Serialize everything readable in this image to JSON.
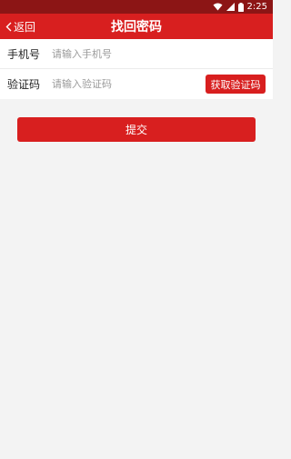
{
  "status_bar": {
    "time": "2:25"
  },
  "nav": {
    "back_label": "返回",
    "title": "找回密码"
  },
  "form": {
    "phone": {
      "label": "手机号",
      "placeholder": "请输入手机号",
      "value": ""
    },
    "code": {
      "label": "验证码",
      "placeholder": "请输入验证码",
      "value": "",
      "button_label": "获取验证码"
    }
  },
  "submit_label": "提交",
  "colors": {
    "primary": "#d81f1f",
    "status_bar": "#8c1515",
    "background": "#f3f3f3"
  },
  "icons": {
    "back": "chevron-left-icon",
    "wifi": "wifi-icon",
    "signal": "cell-signal-icon",
    "battery": "battery-icon"
  }
}
